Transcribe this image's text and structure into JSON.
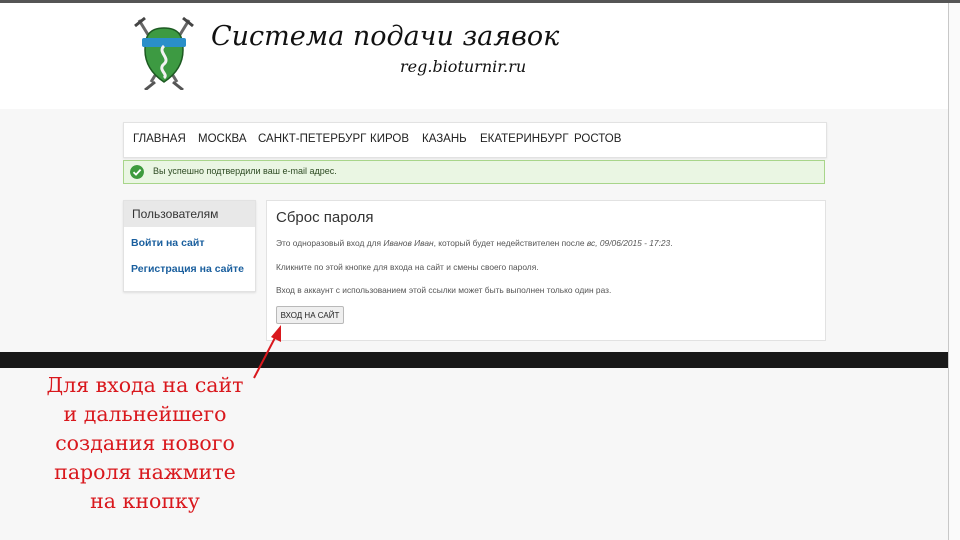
{
  "header": {
    "title": "Система подачи заявок",
    "subtitle": "reg.bioturnir.ru"
  },
  "nav": {
    "items": [
      "ГЛАВНАЯ",
      "МОСКВА",
      "САНКТ-ПЕТЕРБУРГ",
      "КИРОВ",
      "КАЗАНЬ",
      "ЕКАТЕРИНБУРГ",
      "РОСТОВ"
    ]
  },
  "alert": {
    "text": "Вы успешно подтвердили ваш e-mail адрес.",
    "color": "#eaf6e3"
  },
  "sidebar": {
    "title": "Пользователям",
    "links": [
      "Войти на сайт",
      "Регистрация на сайте"
    ]
  },
  "content": {
    "title": "Сброс пароля",
    "line1_prefix": "Это одноразовый вход для ",
    "line1_name": "Иванов Иван",
    "line1_middle": ", который будет недействителен после ",
    "line1_date": "вс, 09/06/2015 - 17:23",
    "line1_suffix": ".",
    "line2": "Кликните по этой кнопке для входа на сайт и смены своего пароля.",
    "line3": "Вход в аккаунт с использованием этой ссылки может быть выполнен только один раз.",
    "button": "ВХОД НА САЙТ"
  },
  "annotation": {
    "lines": [
      "Для входа на сайт",
      "и дальнейшего",
      "создания нового",
      "пароля нажмите",
      "на кнопку"
    ],
    "color": "#d9181d"
  },
  "icons": {
    "logo": "emblem-logo-icon",
    "check": "check-icon",
    "arrow": "arrow-icon"
  }
}
